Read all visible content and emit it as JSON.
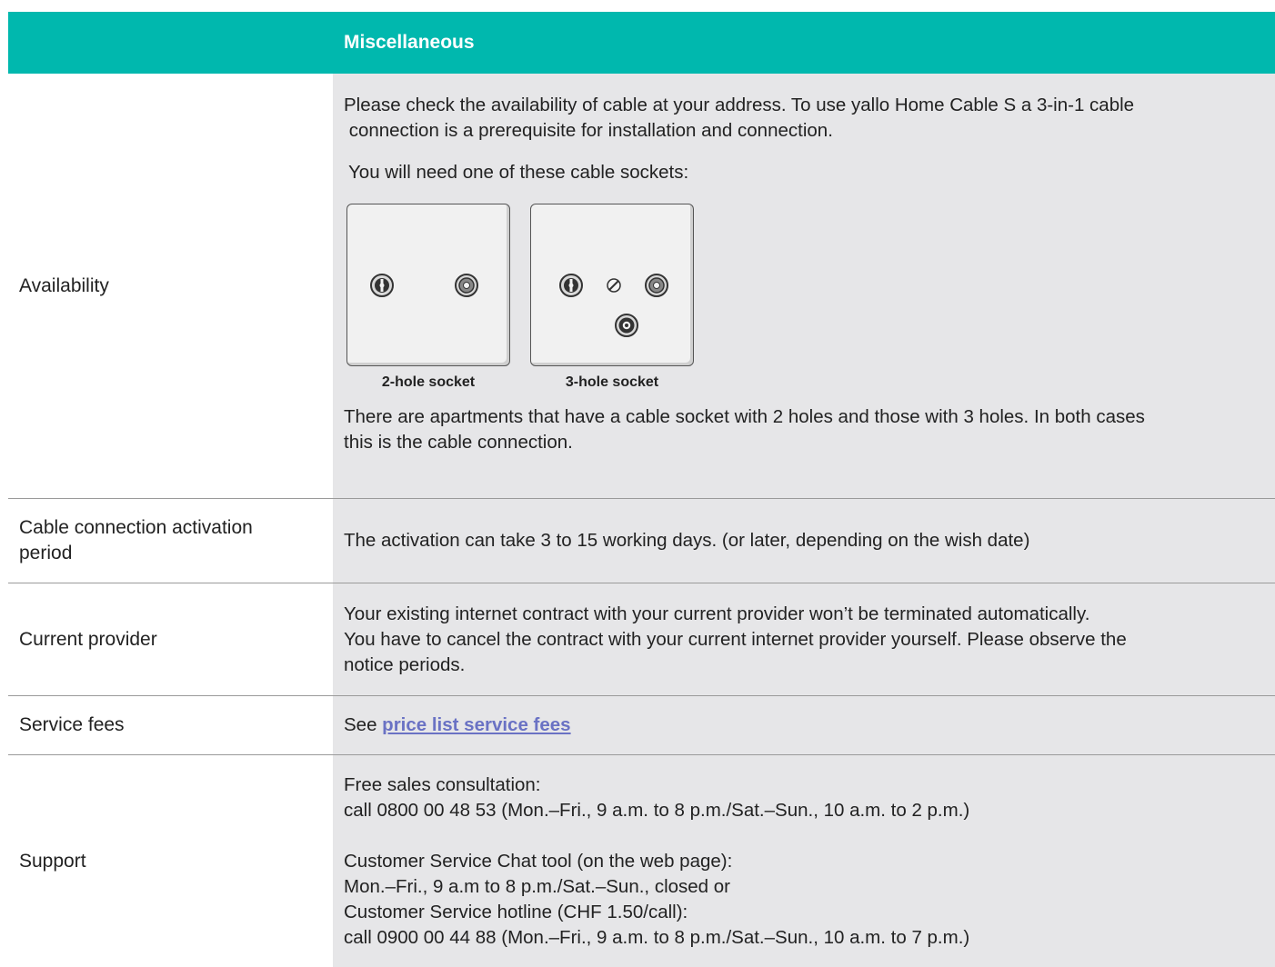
{
  "header": {
    "title": "Miscellaneous"
  },
  "rows": {
    "availability": {
      "label": "Availability",
      "p1_line1": "Please check the availability of cable at your address. To use yallo Home Cable S a 3-in-1 cable",
      "p1_line2": " connection is a prerequisite for installation and connection.",
      "p2": "You will need one of these cable sockets:",
      "socket1_caption": "2-hole socket",
      "socket2_caption": "3-hole socket",
      "p3_line1": "There are apartments that have a cable socket with 2 holes and those with 3 holes. In both cases",
      "p3_line2": "this is the cable connection."
    },
    "activation": {
      "label_line1": "Cable connection activation",
      "label_line2": "period",
      "text": "The activation can take 3 to 15 working days. (or later, depending on the wish date)"
    },
    "provider": {
      "label": "Current provider",
      "line1": "Your existing internet contract with your current provider won’t be terminated automatically.",
      "line2": "You have to cancel the contract with your current internet provider yourself. Please observe the",
      "line3": "notice periods."
    },
    "fees": {
      "label": "Service fees",
      "prefix": "See ",
      "link": "price list service fees"
    },
    "support": {
      "label": "Support",
      "l1": "Free sales consultation:",
      "l2": "call 0800 00 48 53 (Mon.–Fri., 9 a.m. to 8 p.m./Sat.–Sun., 10 a.m. to 2 p.m.)",
      "l3": "Customer Service Chat tool (on the web page):",
      "l4": "Mon.–Fri., 9 a.m to 8 p.m./Sat.–Sun., closed or",
      "l5": "Customer Service hotline (CHF 1.50/call):",
      "l6": "call 0900 00 44 88 (Mon.–Fri., 9 a.m. to 8 p.m./Sat.–Sun., 10 a.m. to 7 p.m.)"
    }
  },
  "colors": {
    "header_bg": "#00b8ae",
    "content_bg": "#e6e6e8",
    "link": "#6a72c4"
  }
}
